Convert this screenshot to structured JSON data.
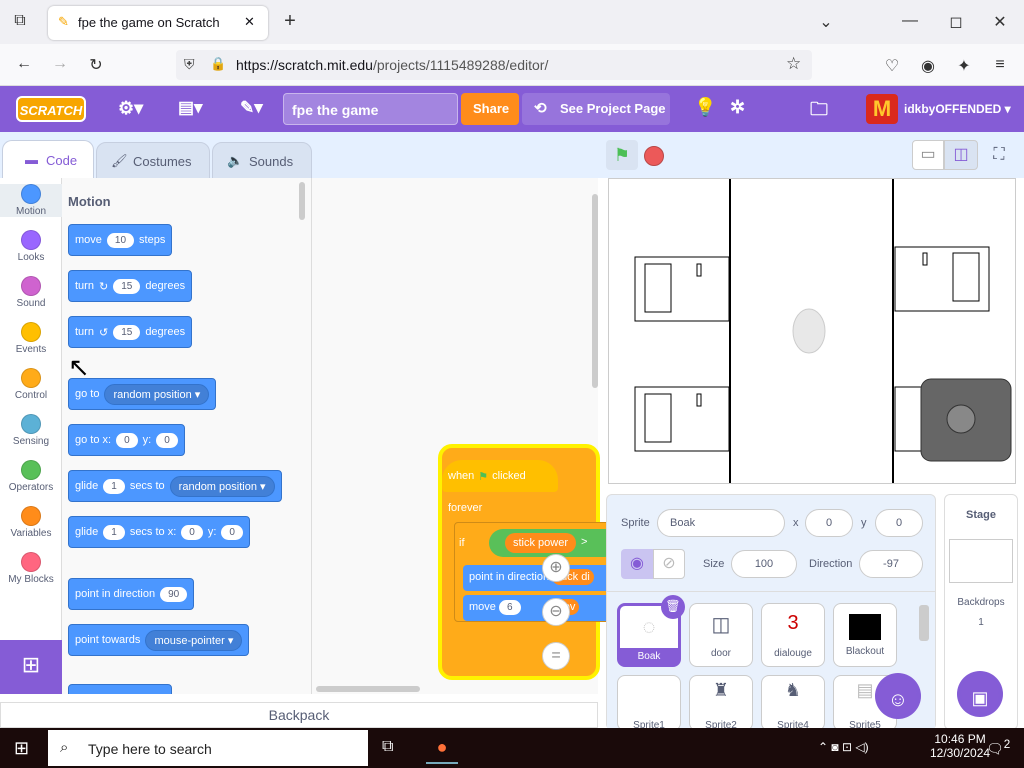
{
  "browser": {
    "tab_title": "fpe the game on Scratch",
    "url_host": "https://scratch.mit.edu",
    "url_path": "/projects/1115489288/editor/",
    "new_tab": "+",
    "min": "—",
    "max": "◻",
    "close": "✕"
  },
  "menu": {
    "logo": "SCRATCH",
    "title_value": "fpe the game",
    "share": "Share",
    "see_project": "See Project Page",
    "user": "idkbyOFFENDED",
    "colors": {
      "brand": "#855cd6",
      "share": "#ff8c1a"
    }
  },
  "tabs": {
    "code": "Code",
    "costumes": "Costumes",
    "sounds": "Sounds"
  },
  "categories": [
    {
      "label": "Motion",
      "color": "#4c97ff"
    },
    {
      "label": "Looks",
      "color": "#9966ff"
    },
    {
      "label": "Sound",
      "color": "#cf63cf"
    },
    {
      "label": "Events",
      "color": "#ffbf00"
    },
    {
      "label": "Control",
      "color": "#ffab19"
    },
    {
      "label": "Sensing",
      "color": "#5cb1d6"
    },
    {
      "label": "Operators",
      "color": "#59c059"
    },
    {
      "label": "Variables",
      "color": "#ff8c1a"
    },
    {
      "label": "My Blocks",
      "color": "#ff6680"
    }
  ],
  "palette": {
    "heading": "Motion",
    "move": "move",
    "move_val": "10",
    "steps": "steps",
    "turn": "turn",
    "turn_val": "15",
    "degrees": "degrees",
    "goto": "go to",
    "random_position": "random position",
    "goto_x": "go to x:",
    "x_val": "0",
    "y_label": "y:",
    "y_val": "0",
    "glide": "glide",
    "glide_secs": "1",
    "secs_to": "secs to",
    "secs_to_x": "secs to x:",
    "point_dir": "point in direction",
    "dir_val": "90",
    "point_towards": "point towards",
    "mouse_pointer": "mouse-pointer"
  },
  "script": {
    "when": "when",
    "clicked": "clicked",
    "forever": "forever",
    "if": "if",
    "stick_power": "stick power",
    "gt": ">",
    "point_in_direction": "point in direction",
    "stick_di": "stick di",
    "move": "move",
    "move_val": "6",
    "pov": "pov"
  },
  "sprite_info": {
    "sprite_label": "Sprite",
    "sprite_name": "Boak",
    "x_label": "x",
    "x_val": "0",
    "y_label": "y",
    "y_val": "0",
    "size_label": "Size",
    "size_val": "100",
    "direction_label": "Direction",
    "direction_val": "-97"
  },
  "sprites": [
    {
      "name": "Boak"
    },
    {
      "name": "door"
    },
    {
      "name": "dialouge",
      "glyph": "3"
    },
    {
      "name": "Blackout"
    },
    {
      "name": "Sprite1"
    },
    {
      "name": "Sprite2"
    },
    {
      "name": "Sprite4"
    },
    {
      "name": "Sprite5"
    }
  ],
  "stage_pane": {
    "title": "Stage",
    "backdrops": "Backdrops",
    "count": "1"
  },
  "backpack": "Backpack",
  "taskbar": {
    "search": "Type here to search",
    "time": "10:46 PM",
    "date": "12/30/2024",
    "notif": "2"
  }
}
